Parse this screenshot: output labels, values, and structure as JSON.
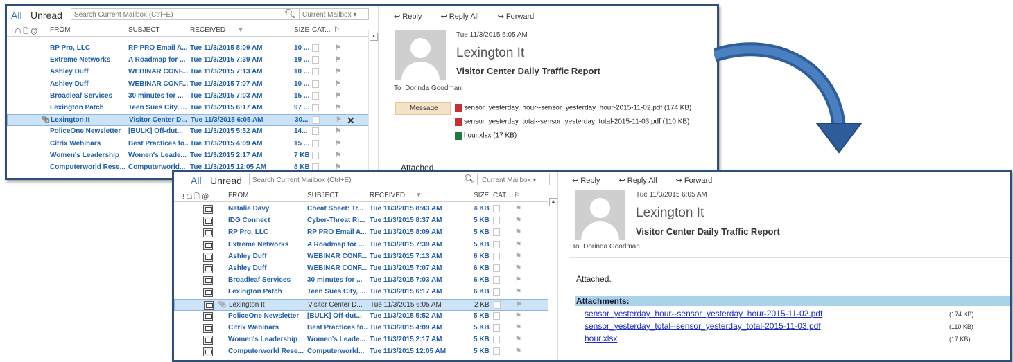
{
  "filters": {
    "all": "All",
    "unread": "Unread"
  },
  "search": {
    "placeholder": "Search Current Mailbox (Ctrl+E)",
    "scope": "Current Mailbox"
  },
  "columns": {
    "icons": "! ☖ 🗋 @",
    "from": "FROM",
    "subject": "SUBJECT",
    "received": "RECEIVED",
    "size": "SIZE",
    "cat": "CAT...",
    "flag": "⚐"
  },
  "panel1": {
    "rows": [
      {
        "from": "RP Pro, LLC",
        "subject": "RP PRO Email A...",
        "received": "Tue 11/3/2015 8:09 AM",
        "size": "10 ..."
      },
      {
        "from": "Extreme Networks",
        "subject": "A Roadmap for ...",
        "received": "Tue 11/3/2015 7:39 AM",
        "size": "19 ..."
      },
      {
        "from": "Ashley Duff",
        "subject": "WEBINAR CONF...",
        "received": "Tue 11/3/2015 7:13 AM",
        "size": "10 ..."
      },
      {
        "from": "Ashley Duff",
        "subject": "WEBINAR CONF...",
        "received": "Tue 11/3/2015 7:07 AM",
        "size": "10 ..."
      },
      {
        "from": "Broadleaf Services",
        "subject": "30 minutes for ...",
        "received": "Tue 11/3/2015 7:03 AM",
        "size": "15 ..."
      },
      {
        "from": "Lexington Patch",
        "subject": "Teen Sues City, ...",
        "received": "Tue 11/3/2015 6:17 AM",
        "size": "97 ..."
      },
      {
        "from": "Lexington It",
        "subject": "Visitor Center D...",
        "received": "Tue 11/3/2015 6:05 AM",
        "size": "30..."
      },
      {
        "from": "PoliceOne Newsletter",
        "subject": "[BULK]  Off-dut...",
        "received": "Tue 11/3/2015 5:52 AM",
        "size": "14..."
      },
      {
        "from": "Citrix Webinars",
        "subject": "Best Practices fo...",
        "received": "Tue 11/3/2015 4:09 AM",
        "size": "15 ..."
      },
      {
        "from": "Women's Leadership",
        "subject": "Women's Leade...",
        "received": "Tue 11/3/2015 2:17 AM",
        "size": "7 KB"
      },
      {
        "from": "Computerworld Rese...",
        "subject": "Computerworld...",
        "received": "Tue 11/3/2015 12:05 AM",
        "size": "8 KB"
      }
    ],
    "reading": {
      "actions": {
        "reply": "Reply",
        "reply_all": "Reply All",
        "forward": "Forward"
      },
      "date": "Tue 11/3/2015 6:05 AM",
      "sender": "Lexington It",
      "subject": "Visitor Center Daily Traffic Report",
      "to_label": "To",
      "to": "Dorinda Goodman",
      "message_tab": "Message",
      "attachments": [
        "sensor_yesterday_hour--sensor_yesterday_hour-2015-11-02.pdf (174 KB)",
        "sensor_yesterday_total--sensor_yesterday_total-2015-11-03.pdf (110 KB)",
        "hour.xlsx (17 KB)"
      ],
      "body": "Attached."
    }
  },
  "panel2": {
    "rows": [
      {
        "from": "Natalie Davy",
        "subject": "Cheat Sheet: Tr...",
        "received": "Tue 11/3/2015 8:43 AM",
        "size": "4 KB"
      },
      {
        "from": "IDG Connect",
        "subject": "Cyber-Threat Ri...",
        "received": "Tue 11/3/2015 8:37 AM",
        "size": "5 KB"
      },
      {
        "from": "RP Pro, LLC",
        "subject": "RP PRO Email A...",
        "received": "Tue 11/3/2015 8:09 AM",
        "size": "5 KB"
      },
      {
        "from": "Extreme Networks",
        "subject": "A Roadmap for ...",
        "received": "Tue 11/3/2015 7:39 AM",
        "size": "5 KB"
      },
      {
        "from": "Ashley Duff",
        "subject": "WEBINAR CONF...",
        "received": "Tue 11/3/2015 7:13 AM",
        "size": "6 KB"
      },
      {
        "from": "Ashley Duff",
        "subject": "WEBINAR CONF...",
        "received": "Tue 11/3/2015 7:07 AM",
        "size": "6 KB"
      },
      {
        "from": "Broadleaf Services",
        "subject": "30 minutes for ...",
        "received": "Tue 11/3/2015 7:03 AM",
        "size": "6 KB"
      },
      {
        "from": "Lexington Patch",
        "subject": "Teen Sues City, ...",
        "received": "Tue 11/3/2015 6:17 AM",
        "size": "6 KB"
      },
      {
        "from": "Lexington It",
        "subject": "Visitor Center D...",
        "received": "Tue 11/3/2015 6:05 AM",
        "size": "2 KB"
      },
      {
        "from": "PoliceOne Newsletter",
        "subject": "[BULK]  Off-dut...",
        "received": "Tue 11/3/2015 5:52 AM",
        "size": "5 KB"
      },
      {
        "from": "Citrix Webinars",
        "subject": "Best Practices fo...",
        "received": "Tue 11/3/2015 4:09 AM",
        "size": "5 KB"
      },
      {
        "from": "Women's Leadership",
        "subject": "Women's Leade...",
        "received": "Tue 11/3/2015 2:17 AM",
        "size": "5 KB"
      },
      {
        "from": "Computerworld Rese...",
        "subject": "Computerworld...",
        "received": "Tue 11/3/2015 12:05 AM",
        "size": "5 KB"
      }
    ],
    "reading": {
      "actions": {
        "reply": "Reply",
        "reply_all": "Reply All",
        "forward": "Forward"
      },
      "date": "Tue 11/3/2015 6:05 AM",
      "sender": "Lexington It",
      "subject": "Visitor Center Daily Traffic Report",
      "to_label": "To",
      "to": "Dorinda Goodman",
      "body": "Attached.",
      "attachments_label": "Attachments:",
      "attachments": [
        {
          "name": "sensor_yesterday_hour--sensor_yesterday_hour-2015-11-02.pdf",
          "size": "(174 KB)"
        },
        {
          "name": "sensor_yesterday_total--sensor_yesterday_total-2015-11-03.pdf",
          "size": "(110 KB)"
        },
        {
          "name": "hour.xlsx",
          "size": "(17 KB)"
        }
      ]
    }
  },
  "colors": {
    "frame": "#2f4e7b",
    "arrow": "#2d5d9a",
    "selected_row": "#cde3f7",
    "link": "#1f5fa8"
  }
}
